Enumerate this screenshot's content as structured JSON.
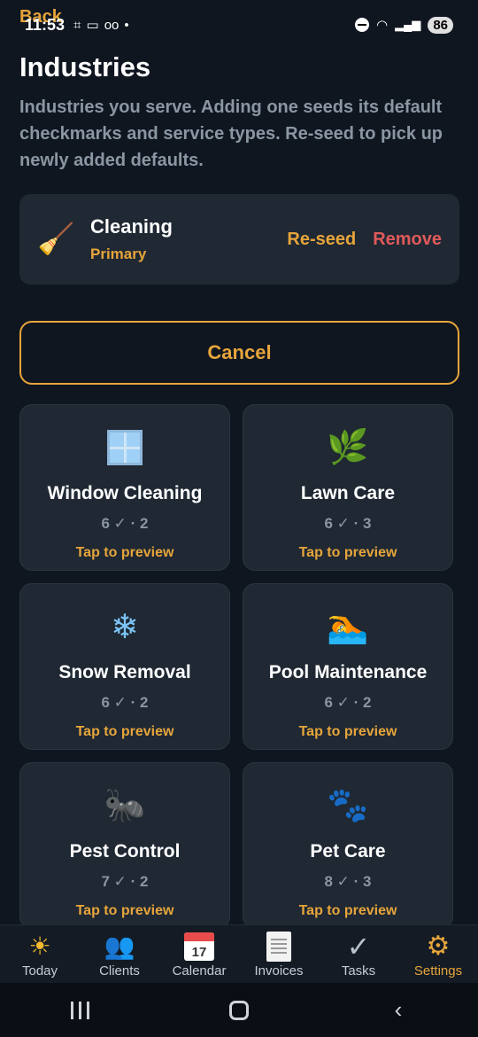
{
  "status_bar": {
    "time": "11:53",
    "battery": "86",
    "back_label": "Back"
  },
  "header": {
    "title": "Industries",
    "description": "Industries you serve. Adding one seeds its default checkmarks and service types. Re-seed to pick up newly added defaults."
  },
  "current_industry": {
    "icon": "broom-icon",
    "name": "Cleaning",
    "tag": "Primary",
    "reseed_label": "Re-seed",
    "remove_label": "Remove"
  },
  "cancel_label": "Cancel",
  "available_industries": [
    {
      "name": "Window Cleaning",
      "icon": "window-icon",
      "stats": "6 ✓ · 2",
      "preview": "Tap to preview"
    },
    {
      "name": "Lawn Care",
      "icon": "herb-icon",
      "stats": "6 ✓ · 3",
      "preview": "Tap to preview"
    },
    {
      "name": "Snow Removal",
      "icon": "snowflake-icon",
      "stats": "6 ✓ · 2",
      "preview": "Tap to preview"
    },
    {
      "name": "Pool Maintenance",
      "icon": "swimmer-icon",
      "stats": "6 ✓ · 2",
      "preview": "Tap to preview"
    },
    {
      "name": "Pest Control",
      "icon": "ant-icon",
      "stats": "7 ✓ · 2",
      "preview": "Tap to preview"
    },
    {
      "name": "Pet Care",
      "icon": "paw-prints-icon",
      "stats": "8 ✓ · 3",
      "preview": "Tap to preview"
    }
  ],
  "tabs": [
    {
      "label": "Today",
      "icon": "sun-icon"
    },
    {
      "label": "Clients",
      "icon": "people-icon"
    },
    {
      "label": "Calendar",
      "icon": "calendar-icon",
      "day": "17"
    },
    {
      "label": "Invoices",
      "icon": "document-icon"
    },
    {
      "label": "Tasks",
      "icon": "checkmark-icon"
    },
    {
      "label": "Settings",
      "icon": "gear-icon"
    }
  ],
  "active_tab": "Settings",
  "colors": {
    "accent": "#e7a53b",
    "danger": "#e05a5a",
    "background": "#0f1620",
    "card": "#1f2833"
  }
}
